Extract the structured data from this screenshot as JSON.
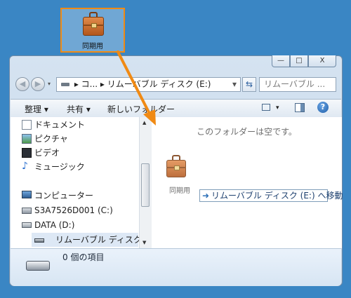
{
  "desktop": {
    "icon_label": "同期用"
  },
  "window": {
    "controls": {
      "minimize": "—",
      "maximize": "□",
      "close": "X"
    },
    "address": {
      "path": "▸ コ... ▸ リムーバブル ディスク (E:)",
      "dropdown": "▾"
    },
    "refresh_icon": "refresh-icon",
    "search_placeholder": "リムーバブル ...",
    "toolbar": {
      "organize": "整理 ▾",
      "share": "共有 ▾",
      "new_folder": "新しいフォルダー",
      "view_arrow": "▾"
    },
    "sidebar": {
      "items": [
        {
          "label": "ドキュメント",
          "icon": "document-icon"
        },
        {
          "label": "ピクチャ",
          "icon": "picture-icon"
        },
        {
          "label": "ビデオ",
          "icon": "video-icon"
        },
        {
          "label": "ミュージック",
          "icon": "music-icon"
        },
        {
          "label": "コンピューター",
          "icon": "computer-icon"
        },
        {
          "label": "S3A7526D001 (C:)",
          "icon": "drive-c-icon"
        },
        {
          "label": "DATA (D:)",
          "icon": "drive-d-icon"
        },
        {
          "label": "リムーバブル ディスク (E:)",
          "icon": "removable-drive-icon"
        }
      ]
    },
    "content": {
      "empty_message": "このフォルダーは空です。",
      "dragged_item_label": "同期用",
      "move_tooltip": "リムーバブル ディスク (E:) へ移動"
    },
    "details": {
      "item_count": "0 個の項目"
    }
  },
  "colors": {
    "desktop": "#3a86c4",
    "highlight": "#f08a14",
    "accent": "#2c6fb7"
  }
}
